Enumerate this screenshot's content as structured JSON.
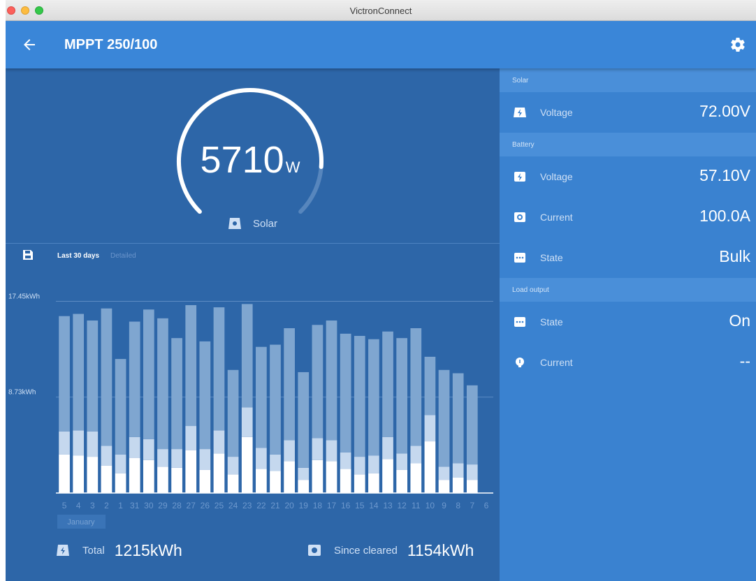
{
  "window": {
    "title": "VictronConnect"
  },
  "header": {
    "title": "MPPT 250/100"
  },
  "gauge": {
    "value": "5710",
    "unit": "W",
    "label": "Solar",
    "fraction": 0.85
  },
  "history": {
    "tab_active": "Last 30 days",
    "tab_inactive": "Detailed",
    "month": "January",
    "total_label": "Total",
    "total_value": "1215kWh",
    "since_label": "Since cleared",
    "since_value": "1154kWh"
  },
  "chart_data": {
    "type": "bar",
    "categories": [
      "5",
      "4",
      "3",
      "2",
      "1",
      "31",
      "30",
      "29",
      "28",
      "27",
      "26",
      "25",
      "24",
      "23",
      "22",
      "21",
      "20",
      "19",
      "18",
      "17",
      "16",
      "15",
      "14",
      "13",
      "12",
      "11",
      "10",
      "9",
      "8",
      "7",
      "6"
    ],
    "ylim": [
      0,
      17.45
    ],
    "ytick_values": [
      8.73,
      17.45
    ],
    "ytick_labels": [
      "8.73kWh",
      "17.45kWh"
    ],
    "series": [
      {
        "values": [
          3.5,
          3.4,
          3.3,
          2.5,
          1.8,
          3.2,
          3.0,
          2.4,
          2.3,
          3.9,
          2.1,
          3.6,
          1.7,
          5.1,
          2.2,
          2.0,
          2.9,
          1.2,
          3.0,
          2.9,
          2.2,
          1.7,
          1.8,
          3.1,
          2.1,
          2.7,
          4.7,
          1.2,
          1.4,
          1.2,
          0
        ]
      },
      {
        "values": [
          2.1,
          2.3,
          2.3,
          1.8,
          1.7,
          1.9,
          1.9,
          1.6,
          1.7,
          2.2,
          1.9,
          2.1,
          1.6,
          2.7,
          1.9,
          1.5,
          1.9,
          1.1,
          2.0,
          1.9,
          1.5,
          1.6,
          1.6,
          2.0,
          1.5,
          1.6,
          2.4,
          1.2,
          1.3,
          1.4,
          0
        ]
      },
      {
        "values": [
          10.5,
          10.6,
          10.1,
          12.5,
          8.7,
          10.5,
          11.8,
          11.9,
          10.1,
          11.0,
          9.8,
          11.2,
          7.9,
          9.4,
          9.2,
          10.0,
          10.2,
          8.7,
          10.3,
          10.9,
          10.8,
          11.0,
          10.6,
          9.6,
          10.5,
          10.7,
          5.3,
          8.8,
          8.2,
          7.2,
          0
        ]
      }
    ]
  },
  "right_panel": {
    "sections": [
      {
        "title": "Solar",
        "rows": [
          {
            "label": "Voltage",
            "value": "72.00V",
            "icon": "solar-panel-icon"
          }
        ]
      },
      {
        "title": "Battery",
        "rows": [
          {
            "label": "Voltage",
            "value": "57.10V",
            "icon": "battery-icon"
          },
          {
            "label": "Current",
            "value": "100.0A",
            "icon": "current-icon"
          },
          {
            "label": "State",
            "value": "Bulk",
            "icon": "state-icon"
          }
        ]
      },
      {
        "title": "Load output",
        "rows": [
          {
            "label": "State",
            "value": "On",
            "icon": "state-icon"
          },
          {
            "label": "Current",
            "value": "--",
            "icon": "bulb-icon"
          }
        ]
      }
    ]
  },
  "colors": {
    "header": "#3a86d8",
    "left_pane": "#2d66a8",
    "right_pane": "#3a82d0",
    "bar_bottom": "#ffffff",
    "bar_middle": "#c5d8ee",
    "bar_top": "#7fa6d0"
  }
}
